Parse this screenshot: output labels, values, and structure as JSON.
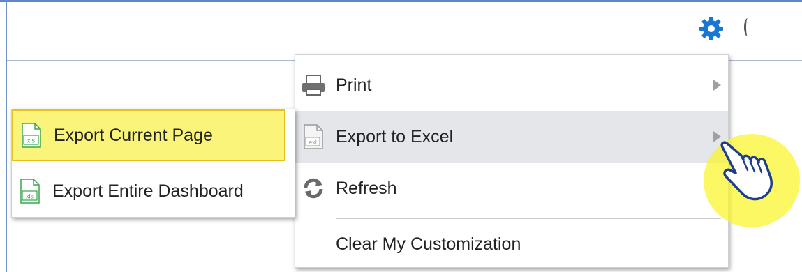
{
  "header": {
    "settings_icon": "gear-icon"
  },
  "menu": {
    "items": [
      {
        "label": "Print",
        "icon": "printer-icon",
        "has_submenu": true
      },
      {
        "label": "Export to Excel",
        "icon": "excel-file-icon",
        "has_submenu": true,
        "highlighted": true
      },
      {
        "label": "Refresh",
        "icon": "refresh-icon",
        "has_submenu": false
      },
      {
        "label": "Clear My Customization",
        "icon": "",
        "has_submenu": false
      }
    ]
  },
  "submenu": {
    "items": [
      {
        "label": "Export Current Page",
        "icon": "xls-file-icon",
        "highlighted": true
      },
      {
        "label": "Export Entire Dashboard",
        "icon": "xls-file-icon",
        "highlighted": false
      }
    ]
  },
  "colors": {
    "accent_blue": "#1976d2",
    "hover_gray": "#e4e6e9",
    "highlight_yellow": "#fbf47a",
    "xls_green": "#3aa54b"
  }
}
